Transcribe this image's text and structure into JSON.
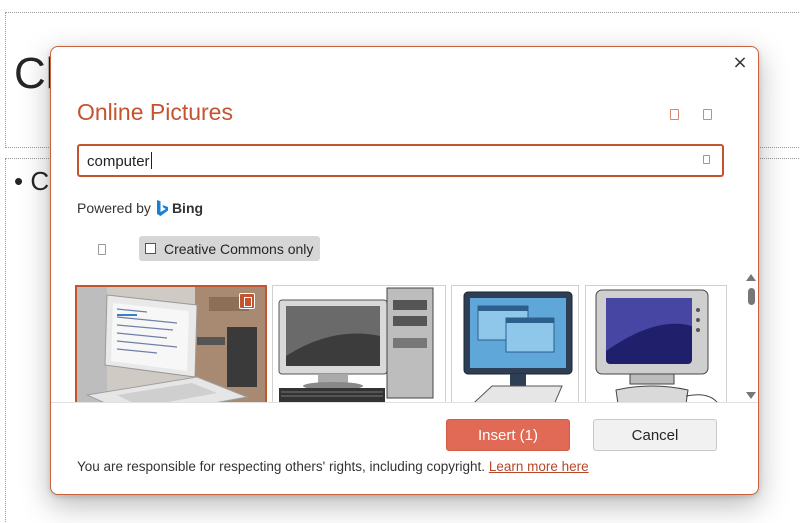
{
  "slide": {
    "title_fragment": "Cl",
    "body_fragment": "• C"
  },
  "dialog": {
    "title": "Online Pictures",
    "close_glyph": "×",
    "search": {
      "value": "computer"
    },
    "powered_by": "Powered by",
    "bing_label": "Bing",
    "filter": {
      "creative_commons_label": "Creative Commons only",
      "creative_commons_checked": false
    },
    "results": [
      {
        "name": "laptop-on-stand-photo",
        "selected": true
      },
      {
        "name": "desktop-computer-clipart",
        "selected": false
      },
      {
        "name": "computer-monitor-clipart",
        "selected": false
      },
      {
        "name": "crt-computer-clipart",
        "selected": false
      }
    ],
    "buttons": {
      "insert_label": "Insert (1)",
      "cancel_label": "Cancel"
    },
    "footer": {
      "notice": "You are responsible for respecting others' rights, including copyright.",
      "link": "Learn more here"
    }
  },
  "colors": {
    "accent": "#c4532f",
    "insert_button": "#e06a55",
    "link": "#b7472a"
  }
}
